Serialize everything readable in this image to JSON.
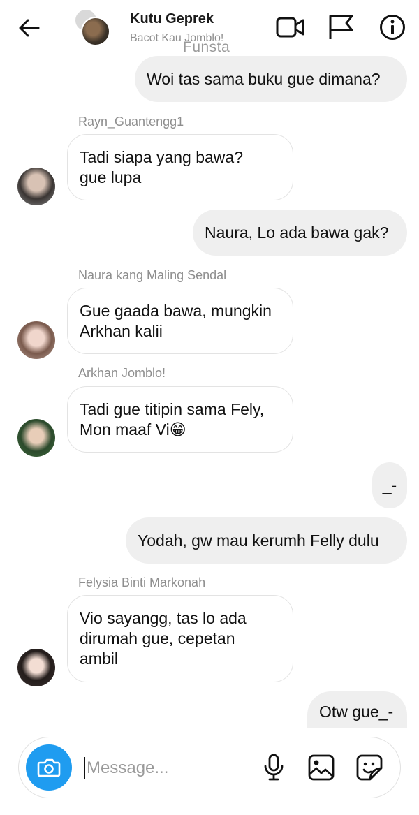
{
  "header": {
    "title": "Kutu Geprek",
    "subtitle": "Bacot Kau Jomblo!",
    "watermark": "Funsta",
    "icons": [
      "back-arrow-icon",
      "video-call-icon",
      "flag-icon",
      "info-icon"
    ]
  },
  "messages": [
    {
      "type": "outgoing",
      "text": "Woi tas sama buku gue dimana?"
    },
    {
      "type": "incoming",
      "sender": "Rayn_Guantengg1",
      "lines": [
        "Tadi siapa yang bawa?",
        "gue lupa"
      ]
    },
    {
      "type": "outgoing",
      "text": "Naura, Lo ada bawa gak?"
    },
    {
      "type": "incoming",
      "sender": "Naura kang Maling Sendal",
      "lines": [
        "Gue gaada bawa, mungkin",
        "Arkhan kalii"
      ]
    },
    {
      "type": "incoming",
      "sender": "Arkhan Jomblo!",
      "lines": [
        "Tadi gue titipin sama Fely,",
        "Mon maaf Vi"
      ],
      "emoji": "😁"
    },
    {
      "type": "outgoing",
      "text": "_-"
    },
    {
      "type": "outgoing",
      "text": "Yodah, gw mau kerumh Felly dulu"
    },
    {
      "type": "incoming",
      "sender": "Felysia Binti Markonah",
      "lines": [
        "Vio sayangg, tas lo ada",
        "dirumah gue, cepetan",
        "ambil"
      ]
    },
    {
      "type": "outgoing",
      "text": "Otw gue_-"
    }
  ],
  "composer": {
    "placeholder": "Message...",
    "icons": [
      "camera-icon",
      "microphone-icon",
      "gallery-icon",
      "sticker-icon"
    ]
  },
  "colors": {
    "outgoing_bubble": "#efefef",
    "incoming_border": "#e3e3e3",
    "camera_button": "#1f9cf0",
    "secondary_text": "#8e8e8e"
  }
}
